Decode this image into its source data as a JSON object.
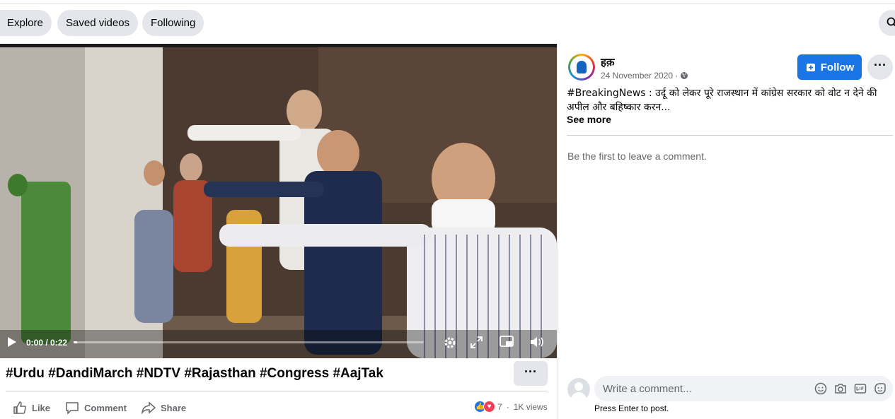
{
  "nav": {
    "tabs": [
      "Explore",
      "Saved videos",
      "Following"
    ]
  },
  "video": {
    "time": "0:00 / 0:22",
    "progress_fraction": 0.01
  },
  "post": {
    "title": "#Urdu #DandiMarch #NDTV #Rajasthan #Congress #AajTak",
    "more_label": "···",
    "actions": {
      "like": "Like",
      "comment": "Comment",
      "share": "Share"
    },
    "reaction_count": "7",
    "views": "1K views"
  },
  "sidebar": {
    "page_name": "हक़",
    "date": "24 November 2020 ·",
    "follow_label": "Follow",
    "more_label": "···",
    "caption": "#BreakingNews : उर्दू को लेकर पूरे राजस्थान में कांग्रेस सरकार को वोट न देने की अपील और बहिष्कार करन...",
    "see_more": "See more",
    "empty_comments": "Be the first to leave a comment.",
    "comment_placeholder": "Write a comment...",
    "enter_hint": "Press Enter to post."
  },
  "colors": {
    "accent": "#1b74e4",
    "pill_bg": "#e4e6eb",
    "muted_text": "#65676b"
  }
}
